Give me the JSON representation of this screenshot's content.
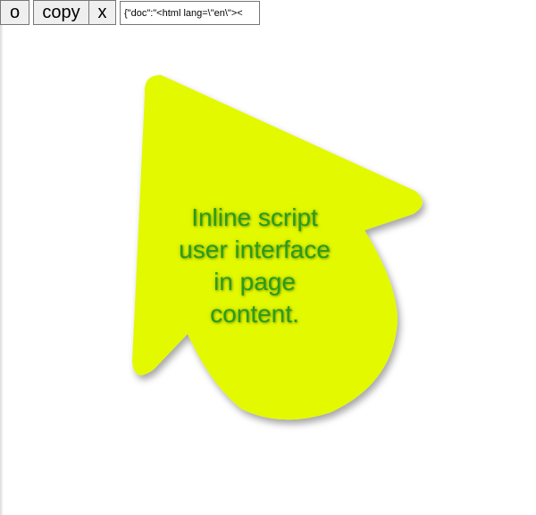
{
  "toolbar": {
    "o_label": "o",
    "copy_label": "copy",
    "x_label": "x",
    "doc_field_value": "{\"doc\":\"<html lang=\\\"en\\\"><"
  },
  "content": {
    "blob_fill_color": "#e3f900",
    "text_color": "#2a9c1a",
    "lines": [
      "Inline script",
      "user interface",
      "in page",
      "content."
    ]
  }
}
